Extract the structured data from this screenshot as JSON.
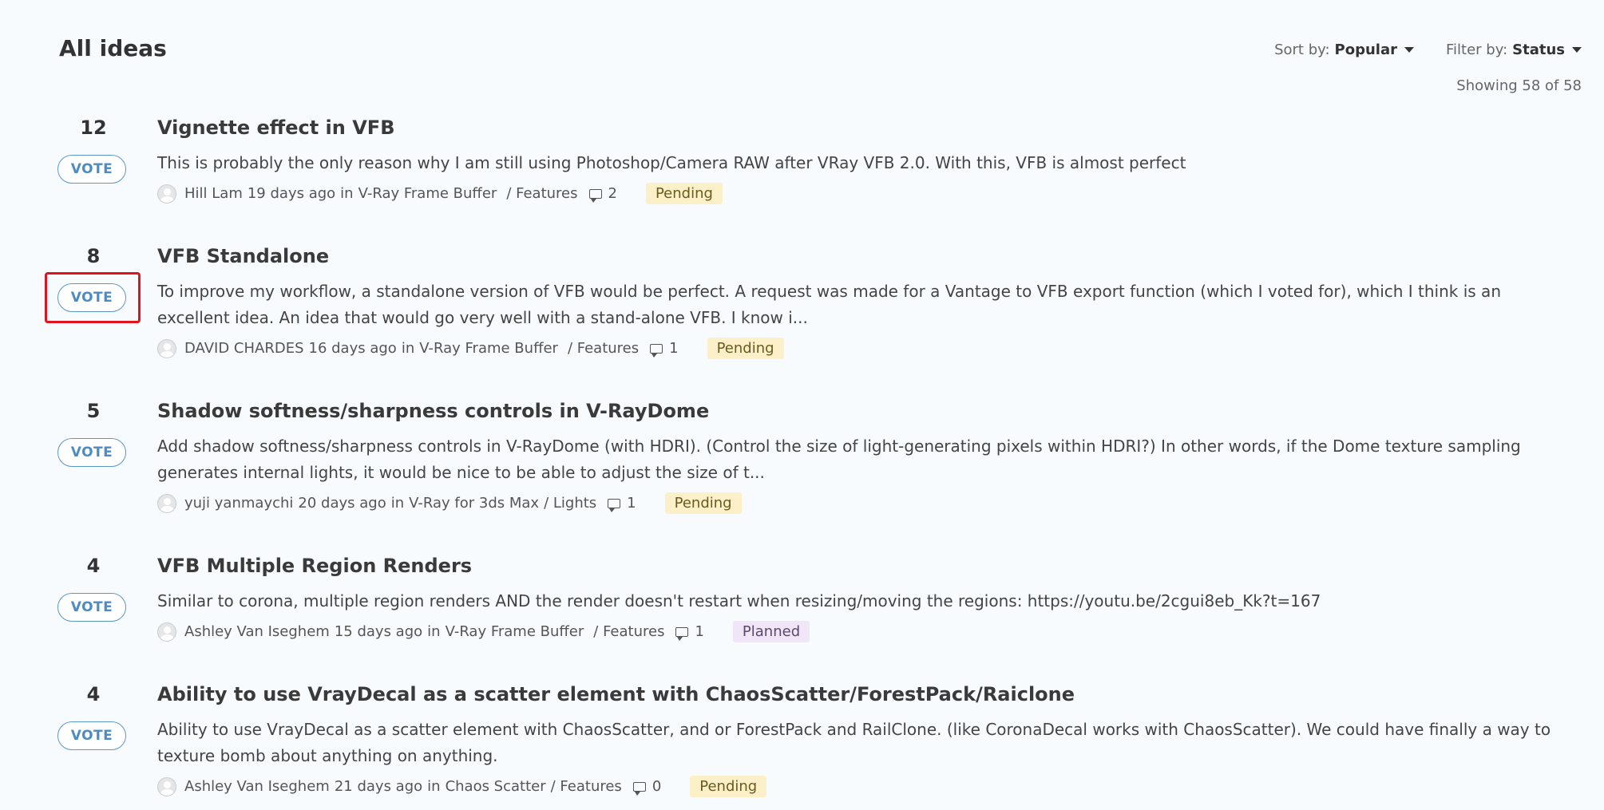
{
  "header": {
    "title": "All ideas",
    "sort_label": "Sort by:",
    "sort_value": "Popular",
    "filter_label": "Filter by:",
    "filter_value": "Status",
    "showing": "Showing 58 of 58"
  },
  "vote_label": "VOTE",
  "ideas": [
    {
      "votes": "12",
      "title": "Vignette effect in VFB",
      "description": "This is probably the only reason why I am still using Photoshop/Camera RAW after VRay VFB 2.0. With this, VFB is almost perfect",
      "author": "Hill Lam",
      "time": "19 days ago",
      "in": "in",
      "category": "V-Ray Frame Buffer",
      "subcategory": "/ Features",
      "comments": "2",
      "status": "Pending"
    },
    {
      "votes": "8",
      "title": "VFB Standalone",
      "description": "To improve my workflow, a standalone version of VFB would be perfect. A request was made for a Vantage to VFB export function (which I voted for), which I think is an excellent idea. An idea that would go very well with a stand-alone VFB. I know i...",
      "author": "DAVID CHARDES",
      "time": "16 days ago",
      "in": "in",
      "category": "V-Ray Frame Buffer",
      "subcategory": "/ Features",
      "comments": "1",
      "status": "Pending"
    },
    {
      "votes": "5",
      "title": "Shadow softness/sharpness controls in V-RayDome",
      "description": "Add shadow softness/sharpness controls in V-RayDome (with HDRI). (Control the size of light-generating pixels within HDRI?) In other words, if the Dome texture sampling generates internal lights, it would be nice to be able to adjust the size of t...",
      "author": "yuji yanmaychi",
      "time": "20 days ago",
      "in": "in",
      "category": "V-Ray for 3ds Max",
      "subcategory": "/ Lights",
      "comments": "1",
      "status": "Pending"
    },
    {
      "votes": "4",
      "title": "VFB Multiple Region Renders",
      "description": "Similar to corona, multiple region renders AND the render doesn't restart when resizing/moving the regions: https://youtu.be/2cgui8eb_Kk?t=167",
      "author": "Ashley Van Iseghem",
      "time": "15 days ago",
      "in": "in",
      "category": "V-Ray Frame Buffer",
      "subcategory": "/ Features",
      "comments": "1",
      "status": "Planned"
    },
    {
      "votes": "4",
      "title": "Ability to use VrayDecal as a scatter element with ChaosScatter/ForestPack/Raiclone",
      "description": "Ability to use VrayDecal as a scatter element with ChaosScatter, and or ForestPack and RailClone. (like CoronaDecal works with ChaosScatter). We could have finally a way to texture bomb about anything on anything.",
      "author": "Ashley Van Iseghem",
      "time": "21 days ago",
      "in": "in",
      "category": "Chaos Scatter",
      "subcategory": "/ Features",
      "comments": "0",
      "status": "Pending"
    }
  ]
}
